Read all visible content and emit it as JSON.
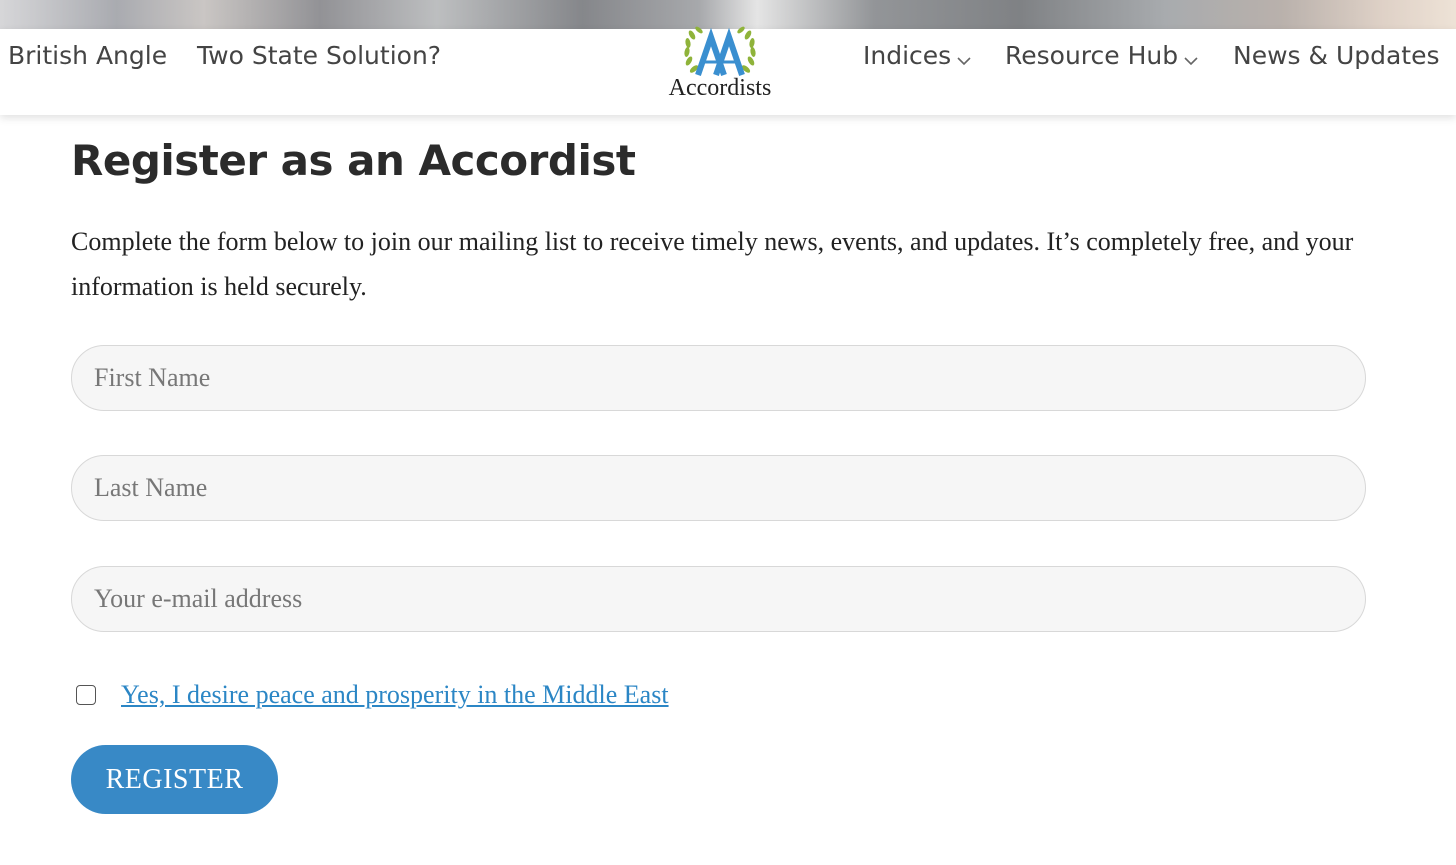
{
  "nav": {
    "left_items": [
      {
        "label": "British Angle"
      },
      {
        "label": "Two State Solution?"
      }
    ],
    "right_items": [
      {
        "label": "Indices",
        "has_dropdown": true
      },
      {
        "label": "Resource Hub",
        "has_dropdown": true
      },
      {
        "label": "News & Updates",
        "has_dropdown": false
      }
    ],
    "logo_text": "Accordists",
    "logo_icon": "laurel-aa-icon"
  },
  "page": {
    "title": "Register as an Accordist",
    "intro": "Complete the form below to join our mailing list to receive timely news, events, and updates. It’s completely free, and your information is held securely."
  },
  "form": {
    "first_name": {
      "placeholder": "First Name",
      "value": ""
    },
    "last_name": {
      "placeholder": "Last Name",
      "value": ""
    },
    "email": {
      "placeholder": "Your e-mail address",
      "value": ""
    },
    "consent": {
      "label": "Yes, I desire peace and prosperity in the Middle East",
      "checked": false
    },
    "submit_label": "REGISTER"
  },
  "colors": {
    "accent": "#3889c6",
    "link": "#2b86c5",
    "logo_blue": "#3a8fd0",
    "laurel_green": "#8fb33a"
  }
}
